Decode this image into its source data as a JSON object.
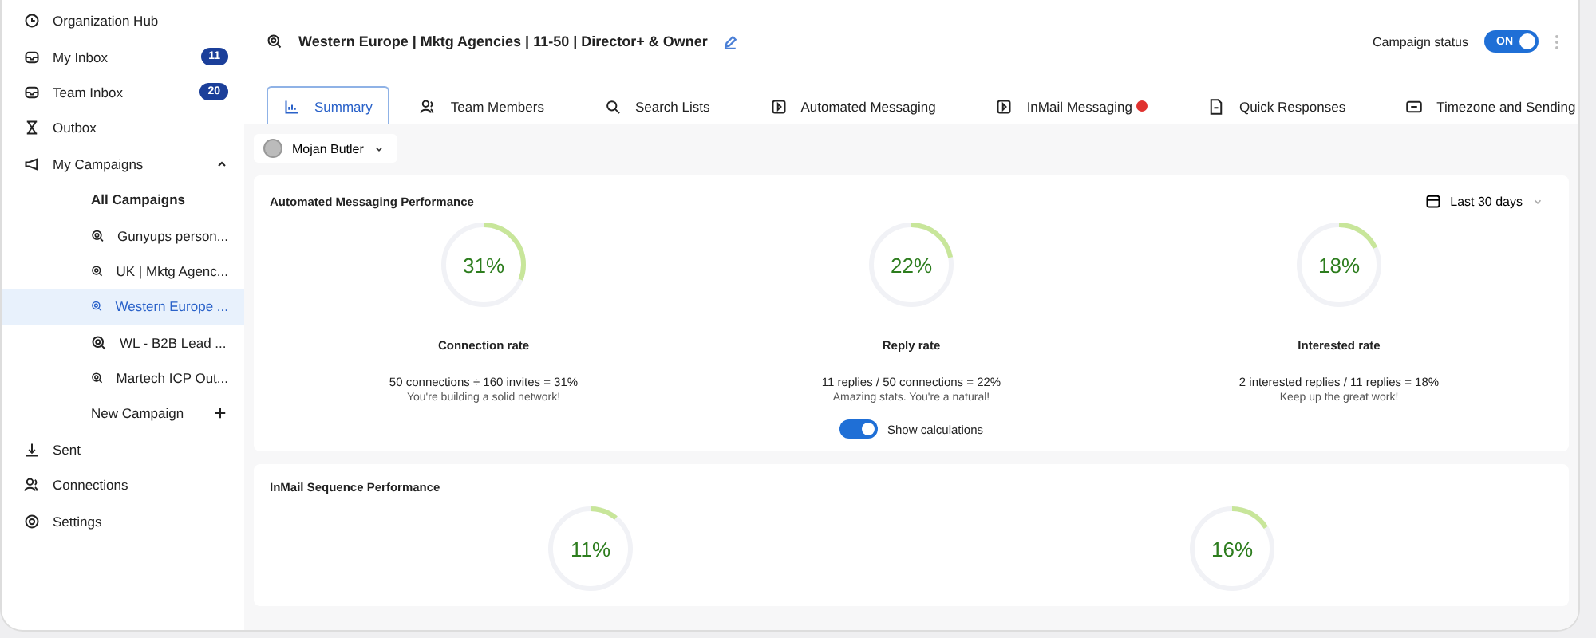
{
  "sidebar": {
    "items": [
      {
        "label": "Organization Hub",
        "selected": false
      },
      {
        "label": "My Inbox",
        "badge": "11",
        "selected": false
      },
      {
        "label": "Team Inbox",
        "badge": "20",
        "selected": false
      },
      {
        "label": "Outbox",
        "selected": false
      },
      {
        "label": "My Campaigns",
        "expanded": true,
        "selected": false,
        "children": [
          {
            "label": "All Campaigns",
            "kind": "plain",
            "selected": false
          },
          {
            "label": "Gunyups person...",
            "kind": "campaign",
            "selected": false
          },
          {
            "label": "UK | Mktg Agenc...",
            "kind": "campaign",
            "selected": false
          },
          {
            "label": "Western Europe ...",
            "kind": "campaign",
            "selected": true
          },
          {
            "label": "WL - B2B Lead ...",
            "kind": "campaign",
            "selected": false
          },
          {
            "label": "Martech ICP Out...",
            "kind": "campaign",
            "selected": false
          },
          {
            "label": "New Campaign",
            "kind": "add",
            "selected": false
          }
        ]
      },
      {
        "label": "Sent",
        "selected": false
      },
      {
        "label": "Connections",
        "selected": false
      },
      {
        "label": "Settings",
        "selected": false
      }
    ]
  },
  "header": {
    "title": "Western Europe | Mktg Agencies | 11-50 | Director+ & Owner",
    "status_label": "Campaign status",
    "status_on": true,
    "status_text": "ON"
  },
  "tabs": [
    {
      "label": "Summary",
      "selected": true
    },
    {
      "label": "Team Members",
      "selected": false
    },
    {
      "label": "Search Lists",
      "selected": false
    },
    {
      "label": "Automated Messaging",
      "selected": false
    },
    {
      "label": "InMail Messaging",
      "selected": false,
      "alert": true
    },
    {
      "label": "Quick Responses",
      "selected": false
    },
    {
      "label": "Timezone and Sending",
      "selected": false
    }
  ],
  "user_filter": {
    "name": "Mojan Butler"
  },
  "automated_performance": {
    "title": "Automated Messaging Performance",
    "range": "Last 30 days",
    "show_calculations": true,
    "show_calculations_label": "Show calculations",
    "metrics": [
      {
        "value": "31%",
        "level": 0.31,
        "label": "Connection rate",
        "calculation": "50 connections ÷ 160 invites = 31%",
        "note": "You're building a solid network!"
      },
      {
        "value": "22%",
        "level": 0.22,
        "label": "Reply rate",
        "calculation": "11 replies / 50 connections = 22%",
        "note": "Amazing stats. You're a natural!"
      },
      {
        "value": "18%",
        "level": 0.18,
        "label": "Interested rate",
        "calculation": "2 interested replies / 11 replies = 18%",
        "note": "Keep up the great work!"
      }
    ]
  },
  "inmail_performance": {
    "title": "InMail Sequence Performance",
    "metrics": [
      {
        "value": "11%",
        "level": 0.11
      },
      {
        "value": "16%",
        "level": 0.16
      }
    ]
  }
}
